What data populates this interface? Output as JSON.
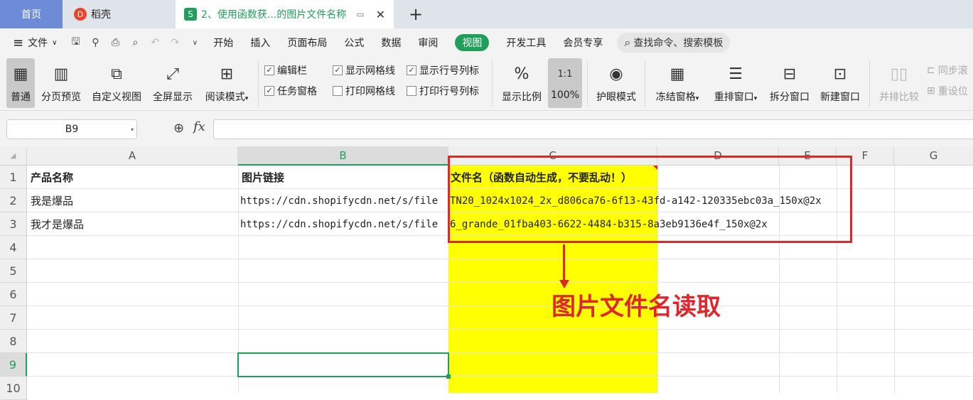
{
  "tabs": {
    "home": "首页",
    "daoke": "稻壳",
    "file": "2、使用函数获...的图片文件名称",
    "file_icon": "S",
    "daoke_icon_char": "D"
  },
  "menu": {
    "file": "文件",
    "items": [
      "开始",
      "插入",
      "页面布局",
      "公式",
      "数据",
      "审阅",
      "视图",
      "开发工具",
      "会员专享"
    ],
    "active": "视图",
    "search": "查找命令、搜索模板"
  },
  "ribbon": {
    "normal": "普通",
    "page_preview": "分页预览",
    "custom_view": "自定义视图",
    "fullscreen": "全屏显示",
    "reading_mode": "阅读模式",
    "chk_formula_bar": "编辑栏",
    "chk_task_pane": "任务窗格",
    "chk_show_grid": "显示网格线",
    "chk_print_grid": "打印网格线",
    "chk_show_headers": "显示行号列标",
    "chk_print_headers": "打印行号列标",
    "zoom": "显示比例",
    "zoom_100": "100%",
    "zoom_100_icon": "1:1",
    "eye_mode": "护眼模式",
    "freeze": "冻结窗格",
    "arrange": "重排窗口",
    "split": "拆分窗口",
    "new_window": "新建窗口",
    "side_by_side": "并排比较",
    "sync_scroll": "同步滚",
    "reset_pos": "重设位"
  },
  "formula_bar": {
    "cell_ref": "B9",
    "fx": "fx",
    "content": ""
  },
  "grid": {
    "columns": [
      "A",
      "B",
      "C",
      "D",
      "E",
      "F",
      "G"
    ],
    "rows": [
      "1",
      "2",
      "3",
      "4",
      "5",
      "6",
      "7",
      "8",
      "9",
      "10"
    ],
    "A1": "产品名称",
    "B1": "图片链接",
    "C1": "文件名（函数自动生成，不要乱动！）",
    "A2": "我是爆品",
    "B2": "https://cdn.shopifycdn.net/s/file",
    "C2": "TN20_1024x1024_2x_d806ca76-6f13-43fd-a142-120335ebc03a_150x@2x",
    "A3": "我才是爆品",
    "B3": "https://cdn.shopifycdn.net/s/file",
    "C3": "6_grande_01fba403-6622-4484-b315-8a3eb9136e4f_150x@2x"
  },
  "annotation": {
    "label": "图片文件名读取",
    "color": "#e0262b"
  },
  "colors": {
    "highlight": "#ffff00",
    "selection": "#1f9f5a",
    "accent": "#1f9f5a"
  }
}
